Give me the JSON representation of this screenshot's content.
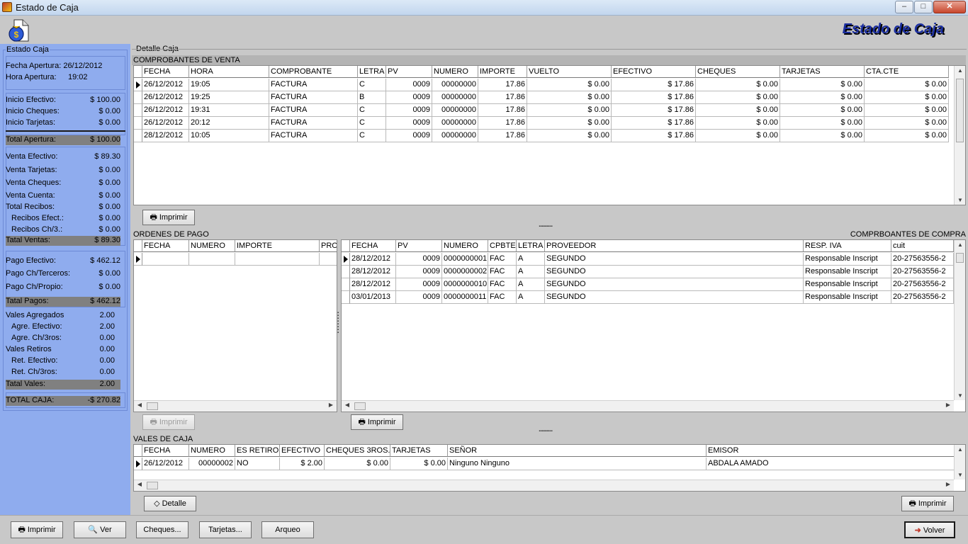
{
  "window": {
    "title": "Estado de Caja",
    "min": "–",
    "max": "□",
    "close": "✕"
  },
  "header": {
    "title": "Estado de Caja",
    "icon": "money-bag-icon"
  },
  "left": {
    "legend": "Estado Caja",
    "fecha_apertura": "Fecha Apertura: 26/12/2012",
    "hora_apertura_label": "Hora Apertura:",
    "hora_apertura_value": "19:02",
    "rows": [
      {
        "k": "Inicio Efectivo:",
        "v": "$ 100.00"
      },
      {
        "k": "Inicio Cheques:",
        "v": "$ 0.00"
      },
      {
        "k": "Inicio Tarjetas:",
        "v": "$ 0.00"
      },
      {
        "k": "Total Apertura:",
        "v": "$ 100.00"
      },
      {
        "k": "Venta Efectivo:",
        "v": "$ 89.30"
      },
      {
        "k": "Venta Tarjetas:",
        "v": "$ 0.00"
      },
      {
        "k": "Venta Cheques:",
        "v": "$ 0.00"
      },
      {
        "k": "Venta Cuenta:",
        "v": "$ 0.00"
      },
      {
        "k": "Total Recibos:",
        "v": "$ 0.00"
      },
      {
        "k": "Recibos Efect.:",
        "v": "$ 0.00"
      },
      {
        "k": "Recibos Ch/3.:",
        "v": "$ 0.00"
      },
      {
        "k": "Tatal Ventas:",
        "v": "$ 89.30"
      },
      {
        "k": "Pago Efectivo:",
        "v": "$ 462.12"
      },
      {
        "k": "Pago Ch/Terceros:",
        "v": "$ 0.00"
      },
      {
        "k": "Pago Ch/Propio:",
        "v": "$ 0.00"
      },
      {
        "k": "Tatal Pagos:",
        "v": "$ 462.12"
      },
      {
        "k": "Vales Agregados",
        "v": "2.00"
      },
      {
        "k": "Agre. Efectivo:",
        "v": "2.00"
      },
      {
        "k": "Agre. Ch/3ros:",
        "v": "0.00"
      },
      {
        "k": "Vales Retiros",
        "v": "0.00"
      },
      {
        "k": "Ret. Efectivo:",
        "v": "0.00"
      },
      {
        "k": "Ret. Ch/3ros:",
        "v": "0.00"
      },
      {
        "k": "Tatal Vales:",
        "v": "2.00"
      },
      {
        "k": "TOTAL CAJA:",
        "v": "-$ 270.82"
      }
    ]
  },
  "detail": {
    "legend": "Detalle Caja"
  },
  "ventas": {
    "title": "COMPROBANTES DE VENTA",
    "columns": [
      "FECHA",
      "HORA",
      "COMPROBANTE",
      "LETRA",
      "PV",
      "NUMERO",
      "IMPORTE",
      "VUELTO",
      "EFECTIVO",
      "CHEQUES",
      "TARJETAS",
      "CTA.CTE"
    ],
    "rows": [
      [
        "26/12/2012",
        "19:05",
        "FACTURA",
        "C",
        "0009",
        "00000000",
        "17.86",
        "$ 0.00",
        "$ 17.86",
        "$ 0.00",
        "$ 0.00",
        "$ 0.00"
      ],
      [
        "26/12/2012",
        "19:25",
        "FACTURA",
        "B",
        "0009",
        "00000000",
        "17.86",
        "$ 0.00",
        "$ 17.86",
        "$ 0.00",
        "$ 0.00",
        "$ 0.00"
      ],
      [
        "26/12/2012",
        "19:31",
        "FACTURA",
        "C",
        "0009",
        "00000000",
        "17.86",
        "$ 0.00",
        "$ 17.86",
        "$ 0.00",
        "$ 0.00",
        "$ 0.00"
      ],
      [
        "26/12/2012",
        "20:12",
        "FACTURA",
        "C",
        "0009",
        "00000000",
        "17.86",
        "$ 0.00",
        "$ 17.86",
        "$ 0.00",
        "$ 0.00",
        "$ 0.00"
      ],
      [
        "28/12/2012",
        "10:05",
        "FACTURA",
        "C",
        "0009",
        "00000000",
        "17.86",
        "$ 0.00",
        "$ 17.86",
        "$ 0.00",
        "$ 0.00",
        "$ 0.00"
      ]
    ],
    "print": "Imprimir"
  },
  "ordenes": {
    "title": "ORDENES DE PAGO",
    "columns": [
      "FECHA",
      "NUMERO",
      "IMPORTE",
      "PRO"
    ],
    "print": "Imprimir"
  },
  "compras": {
    "title": "COMPRBOANTES DE COMPRA",
    "columns": [
      "FECHA",
      "PV",
      "NUMERO",
      "CPBTE",
      "LETRA",
      "PROVEEDOR",
      "RESP. IVA",
      "cuit"
    ],
    "rows": [
      [
        "28/12/2012",
        "0009",
        "0000000001",
        "FAC",
        "A",
        "SEGUNDO",
        "Responsable Inscript",
        "20-27563556-2"
      ],
      [
        "28/12/2012",
        "0009",
        "0000000002",
        "FAC",
        "A",
        "SEGUNDO",
        "Responsable Inscript",
        "20-27563556-2"
      ],
      [
        "28/12/2012",
        "0009",
        "0000000010",
        "FAC",
        "A",
        "SEGUNDO",
        "Responsable Inscript",
        "20-27563556-2"
      ],
      [
        "03/01/2013",
        "0009",
        "0000000011",
        "FAC",
        "A",
        "SEGUNDO",
        "Responsable Inscript",
        "20-27563556-2"
      ]
    ],
    "print": "Imprimir"
  },
  "vales": {
    "title": "VALES DE CAJA",
    "columns": [
      "FECHA",
      "NUMERO",
      "ES RETIRO",
      "EFECTIVO",
      "CHEQUES 3ROS.",
      "TARJETAS",
      "SEÑOR",
      "EMISOR"
    ],
    "rows": [
      [
        "26/12/2012",
        "00000002",
        "NO",
        "$ 2.00",
        "$ 0.00",
        "$ 0.00",
        "Ninguno Ninguno",
        "ABDALA AMADO"
      ]
    ],
    "detalle": "Detalle",
    "print": "Imprimir"
  },
  "bottom": {
    "imprimir": "Imprimir",
    "ver": "Ver",
    "cheques": "Cheques...",
    "tarjetas": "Tarjetas...",
    "arqueo": "Arqueo",
    "volver": "Volver"
  }
}
